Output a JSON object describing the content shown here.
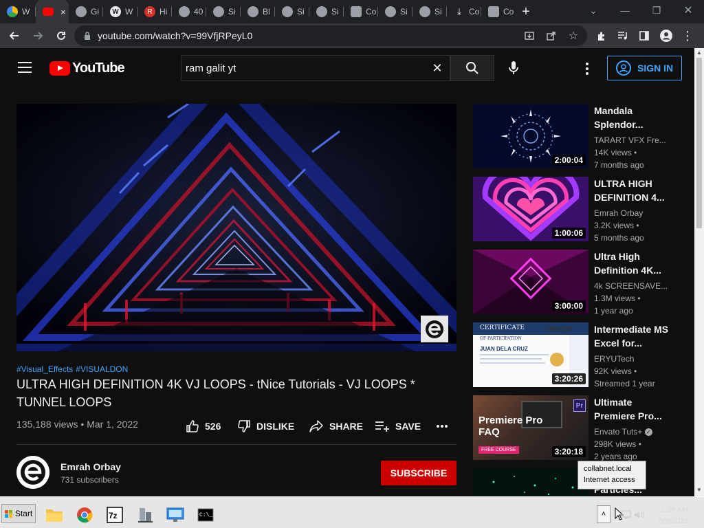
{
  "browser": {
    "tabs": [
      {
        "label": "W",
        "icon": "google-drive-icon"
      },
      {
        "label": "×",
        "icon": "youtube-icon",
        "active": true
      },
      {
        "label": "Gi",
        "icon": "globe-icon"
      },
      {
        "label": "W",
        "icon": "wordpress-icon"
      },
      {
        "label": "Hi",
        "icon": "red-r-icon"
      },
      {
        "label": "40",
        "icon": "globe-icon"
      },
      {
        "label": "Si",
        "icon": "globe-icon"
      },
      {
        "label": "Bl",
        "icon": "globe-icon"
      },
      {
        "label": "Si",
        "icon": "globe-icon"
      },
      {
        "label": "Si",
        "icon": "globe-icon"
      },
      {
        "label": "Co",
        "icon": "extension-icon"
      },
      {
        "label": "Si",
        "icon": "globe-icon"
      },
      {
        "label": "Si",
        "icon": "globe-icon"
      },
      {
        "label": "Co",
        "icon": "download-icon"
      },
      {
        "label": "Co",
        "icon": "extension-icon"
      }
    ],
    "url": "youtube.com/watch?v=99VfjRPeyL0"
  },
  "youtube": {
    "logo_text": "YouTube",
    "search_query": "ram galit yt",
    "signin_label": "SIGN IN"
  },
  "video": {
    "hashtags": [
      "#Visual_Effects",
      "#VISUALDON"
    ],
    "title": "ULTRA HIGH DEFINITION 4K VJ LOOPS - tNice Tutorials - VJ LOOPS * TUNNEL LOOPS",
    "views": "135,188 views",
    "date": "Mar 1, 2022",
    "likes": "526",
    "dislike_label": "DISLIKE",
    "share_label": "SHARE",
    "save_label": "SAVE"
  },
  "channel": {
    "name": "Emrah Orbay",
    "subscribers": "731 subscribers",
    "subscribe_label": "SUBSCRIBE"
  },
  "recommendations": [
    {
      "title": "Mandala Splendor...",
      "channel": "TARART VFX Fre...",
      "views": "14K views",
      "age": "7 months ago",
      "duration": "2:00:04",
      "thumb": "mandala"
    },
    {
      "title": "ULTRA HIGH DEFINITION 4...",
      "channel": "Emrah Orbay",
      "views": "3.2K views",
      "age": "5 months ago",
      "duration": "1:00:06",
      "thumb": "heart"
    },
    {
      "title": "Ultra High Definition 4K...",
      "channel": "4k SCREENSAVE...",
      "views": "1.3M views",
      "age": "1 year ago",
      "duration": "3:00:00",
      "thumb": "magenta"
    },
    {
      "title": "Intermediate MS Excel for...",
      "channel": "ERYUTech",
      "views": "92K views",
      "age": "Streamed 1 year",
      "duration": "3:20:26",
      "thumb": "certificate"
    },
    {
      "title": "Ultimate Premiere Pro...",
      "channel": "Envato Tuts+",
      "views": "298K views",
      "age": "2 years ago",
      "duration": "3:20:18",
      "thumb": "premiere"
    },
    {
      "title": "Particles...",
      "channel": "",
      "views": "",
      "age": "",
      "duration": "",
      "thumb": "particles"
    }
  ],
  "thumb_text": {
    "certificate_heading": "CERTIFICATE",
    "certificate_sub": "OF PARTICIPATION",
    "certificate_org": "SWISSQIT",
    "certificate_name": "JUAN DELA CRUZ",
    "premiere_line1": "Premiere Pro",
    "premiere_line2": "FAQ",
    "premiere_badge": "FREE COURSE",
    "premiere_logo": "Pr"
  },
  "tooltip": {
    "line1": "collabnet.local",
    "line2": "Internet access"
  },
  "taskbar": {
    "start_label": "Start",
    "tray_up": "˄",
    "time": "1:39 AM",
    "date": "8/6/2022"
  }
}
